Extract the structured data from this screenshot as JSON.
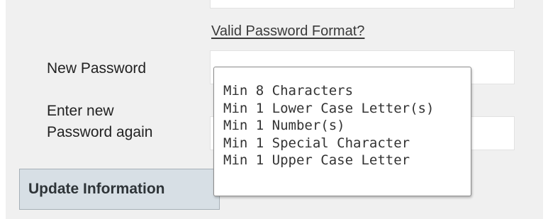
{
  "form": {
    "password_format_link": "Valid Password Format?",
    "new_password_label": "New Password",
    "confirm_password_label_line1": "Enter new",
    "confirm_password_label_line2": "Password again",
    "new_password_value": "",
    "confirm_password_value": "",
    "update_button_label": "Update Information"
  },
  "tooltip": {
    "rules": [
      "Min 8 Characters",
      "Min 1 Lower Case Letter(s)",
      "Min 1 Number(s)",
      "Min 1 Special Character",
      "Min 1 Upper Case Letter"
    ]
  }
}
